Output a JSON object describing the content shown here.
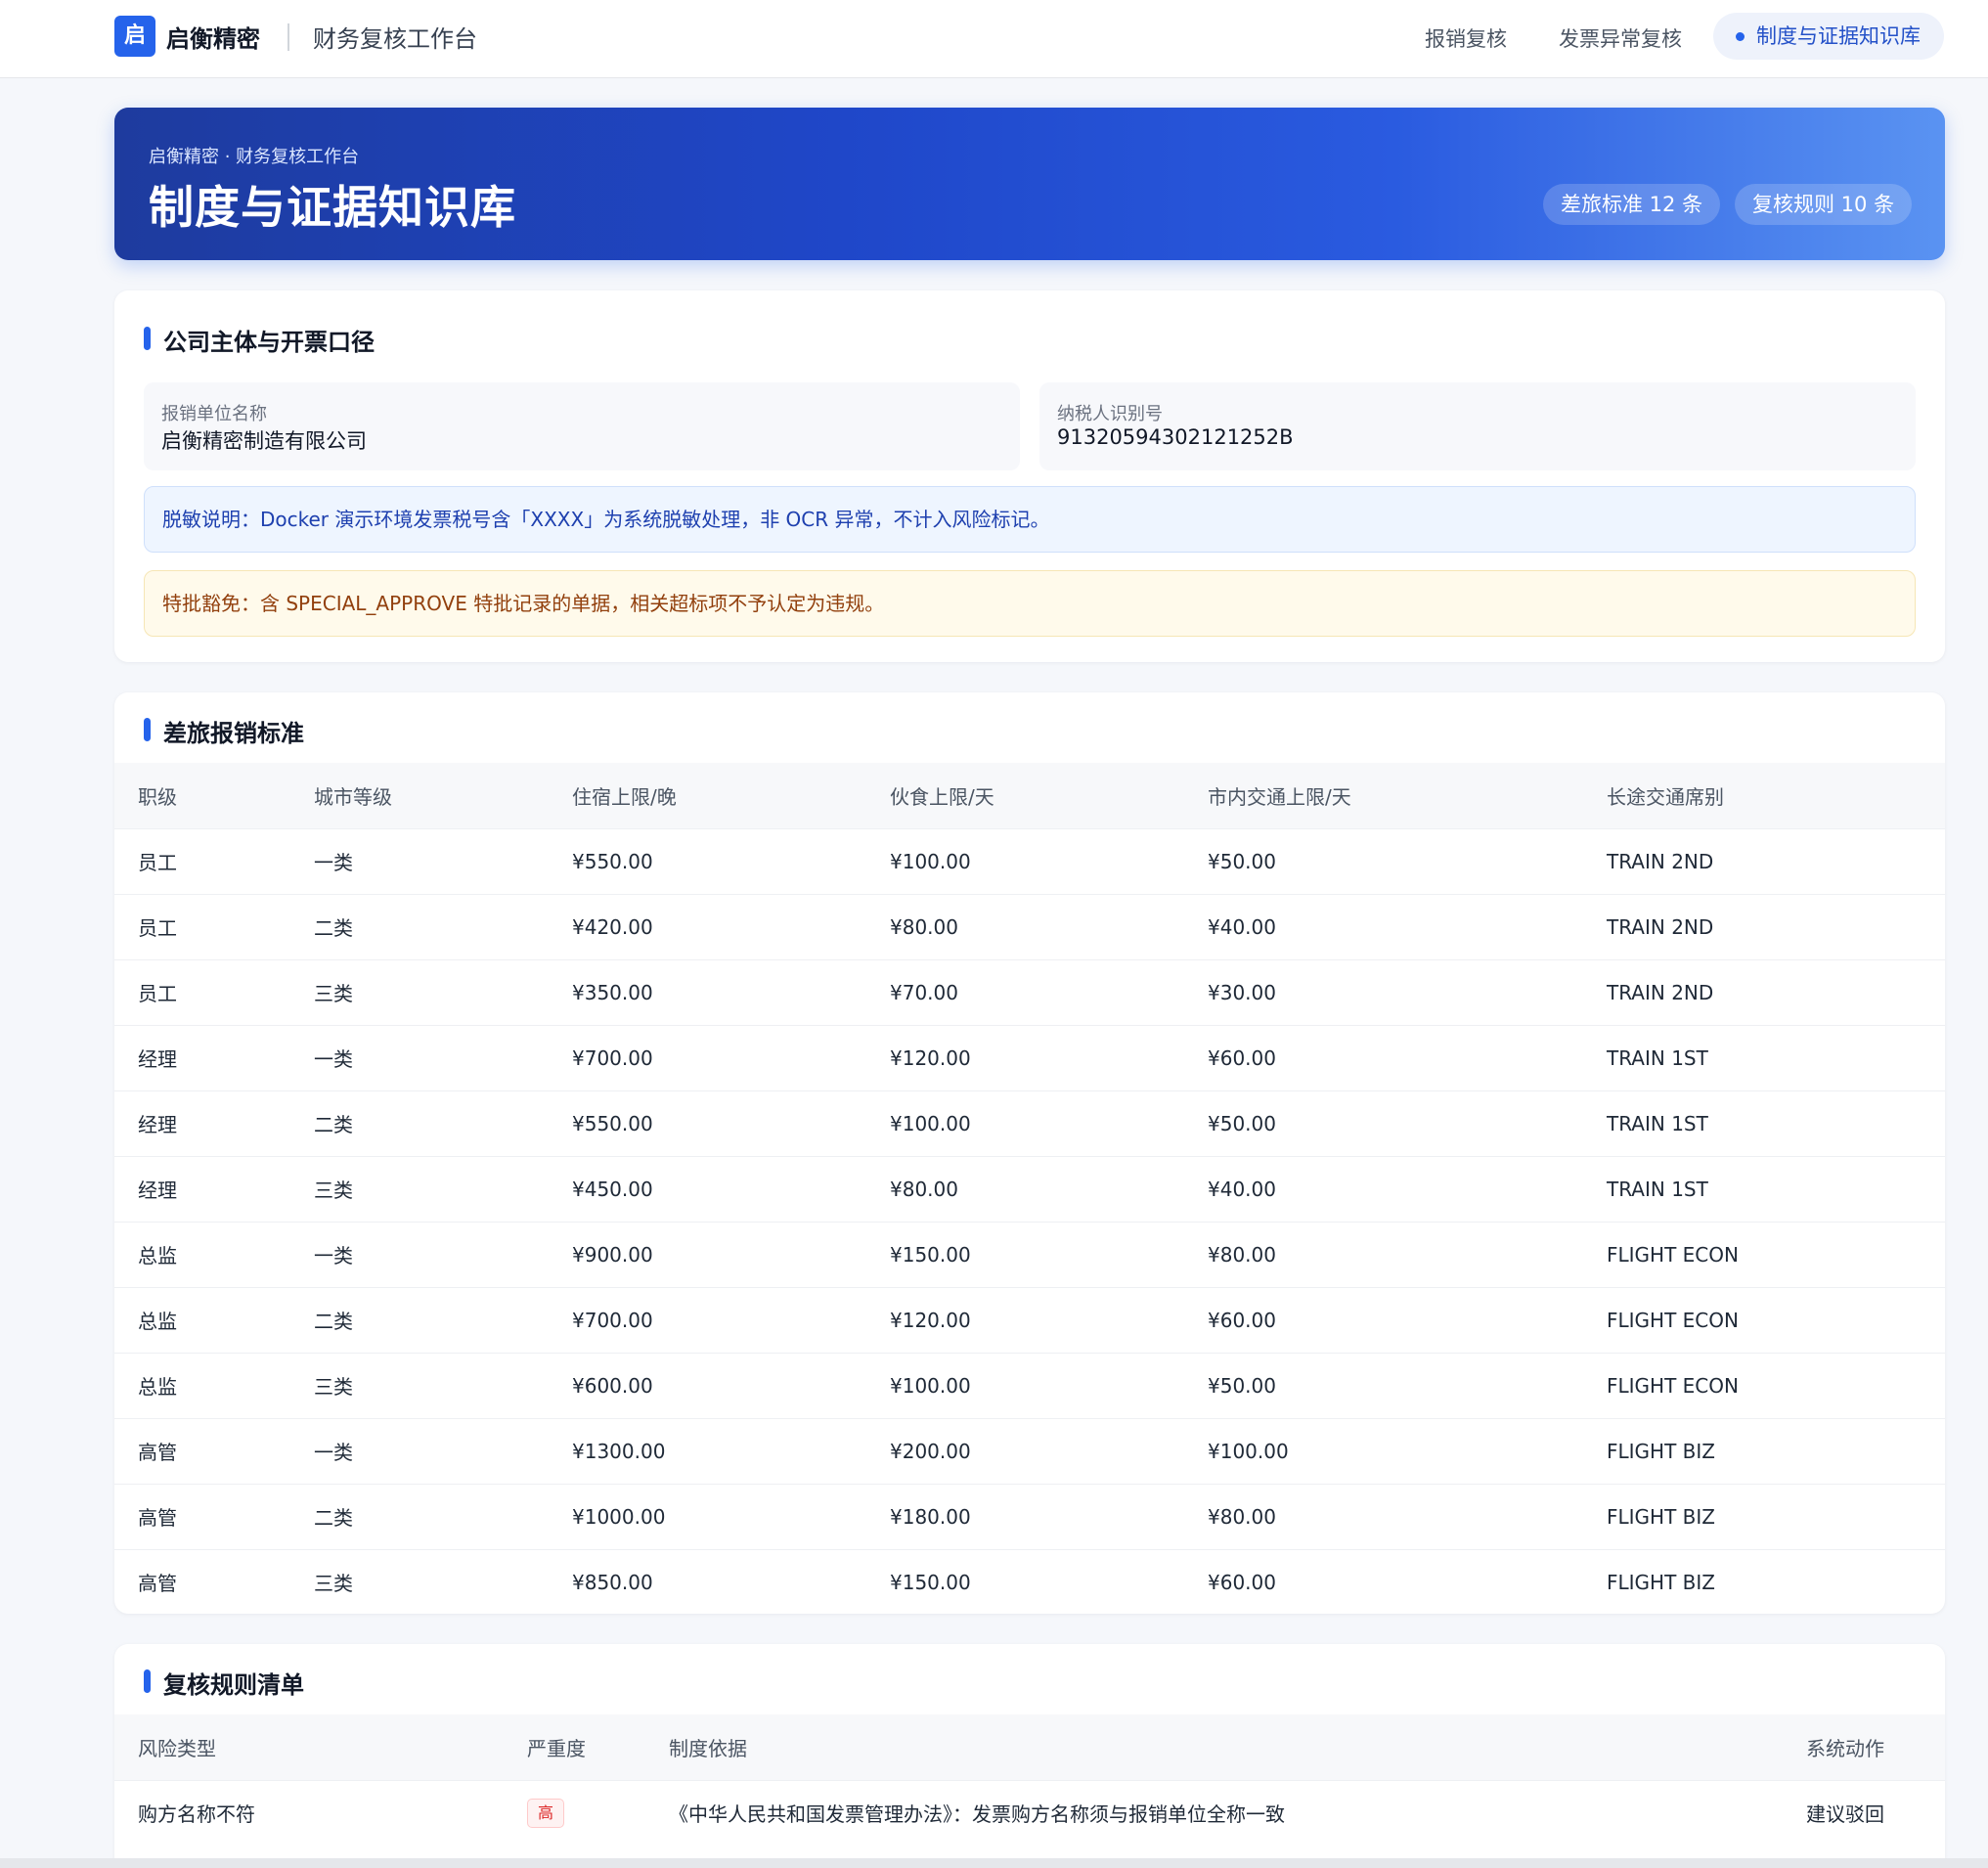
{
  "topbar": {
    "badge": "启",
    "brand": "启衡精密",
    "subtitle": "财务复核工作台",
    "nav": [
      "报销复核",
      "发票异常复核"
    ],
    "active_nav": "制度与证据知识库"
  },
  "hero": {
    "crumb": "启衡精密 · 财务复核工作台",
    "title": "制度与证据知识库",
    "pill_standards": "差旅标准 12 条",
    "pill_rules": "复核规则 10 条"
  },
  "company": {
    "title": "公司主体与开票口径",
    "name_label": "报销单位名称",
    "name_value": "启衡精密制造有限公司",
    "tax_label": "纳税人识别号",
    "tax_value": "91320594302121252B",
    "notice_desensitize": "脱敏说明：Docker 演示环境发票税号含「XXXX」为系统脱敏处理，非 OCR 异常，不计入风险标记。",
    "notice_special": "特批豁免：含 SPECIAL_APPROVE 特批记录的单据，相关超标项不予认定为违规。"
  },
  "travel": {
    "title": "差旅报销标准",
    "headers": [
      "职级",
      "城市等级",
      "住宿上限/晚",
      "伙食上限/天",
      "市内交通上限/天",
      "长途交通席别"
    ],
    "rows": [
      [
        "员工",
        "一类",
        "¥550.00",
        "¥100.00",
        "¥50.00",
        "TRAIN 2ND"
      ],
      [
        "员工",
        "二类",
        "¥420.00",
        "¥80.00",
        "¥40.00",
        "TRAIN 2ND"
      ],
      [
        "员工",
        "三类",
        "¥350.00",
        "¥70.00",
        "¥30.00",
        "TRAIN 2ND"
      ],
      [
        "经理",
        "一类",
        "¥700.00",
        "¥120.00",
        "¥60.00",
        "TRAIN 1ST"
      ],
      [
        "经理",
        "二类",
        "¥550.00",
        "¥100.00",
        "¥50.00",
        "TRAIN 1ST"
      ],
      [
        "经理",
        "三类",
        "¥450.00",
        "¥80.00",
        "¥40.00",
        "TRAIN 1ST"
      ],
      [
        "总监",
        "一类",
        "¥900.00",
        "¥150.00",
        "¥80.00",
        "FLIGHT ECON"
      ],
      [
        "总监",
        "二类",
        "¥700.00",
        "¥120.00",
        "¥60.00",
        "FLIGHT ECON"
      ],
      [
        "总监",
        "三类",
        "¥600.00",
        "¥100.00",
        "¥50.00",
        "FLIGHT ECON"
      ],
      [
        "高管",
        "一类",
        "¥1300.00",
        "¥200.00",
        "¥100.00",
        "FLIGHT BIZ"
      ],
      [
        "高管",
        "二类",
        "¥1000.00",
        "¥180.00",
        "¥80.00",
        "FLIGHT BIZ"
      ],
      [
        "高管",
        "三类",
        "¥850.00",
        "¥150.00",
        "¥60.00",
        "FLIGHT BIZ"
      ]
    ]
  },
  "rules": {
    "title": "复核规则清单",
    "headers": [
      "风险类型",
      "严重度",
      "制度依据",
      "系统动作"
    ],
    "rows": [
      {
        "type": "购方名称不符",
        "severity": "高",
        "basis": "《中华人民共和国发票管理办法》：发票购方名称须与报销单位全称一致",
        "action": "建议驳回"
      }
    ]
  }
}
